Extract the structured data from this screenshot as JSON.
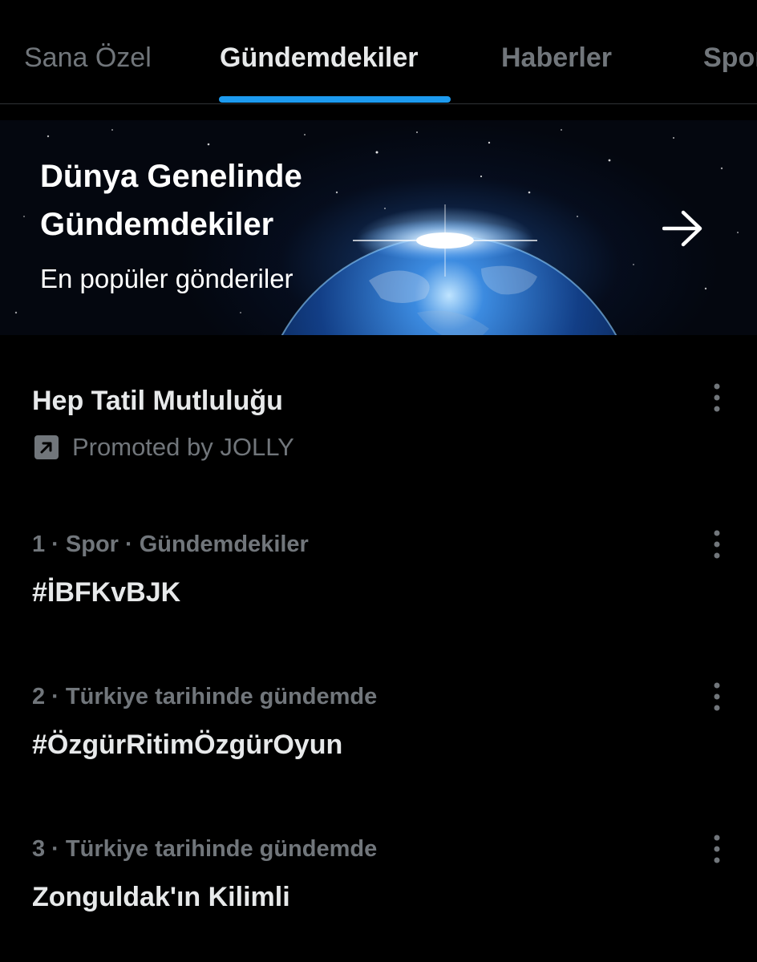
{
  "tabs": [
    {
      "label": "Sana Özel",
      "active": false
    },
    {
      "label": "Gündemdekiler",
      "active": true
    },
    {
      "label": "Haberler",
      "active": false
    },
    {
      "label": "Spor",
      "active": false
    }
  ],
  "banner": {
    "title_line1": "Dünya Genelinde",
    "title_line2": "Gündemdekiler",
    "subtitle": "En popüler gönderiler",
    "arrow_icon": "arrow-right-icon"
  },
  "promoted": {
    "title": "Hep Tatil Mutluluğu",
    "label": "Promoted by JOLLY",
    "icon": "promoted-arrow-icon"
  },
  "trends": [
    {
      "meta": "1 · Spor · Gündemdekiler",
      "title": "#İBFKvBJK"
    },
    {
      "meta": "2 · Türkiye tarihinde gündemde",
      "title": "#ÖzgürRitimÖzgürOyun"
    },
    {
      "meta": "3 · Türkiye tarihinde gündemde",
      "title": "Zonguldak'ın Kilimli"
    }
  ],
  "colors": {
    "background": "#000000",
    "accent": "#1d9bf0",
    "primary_text": "#e7e9ea",
    "secondary_text": "#71767b",
    "divider": "#2f3336"
  }
}
